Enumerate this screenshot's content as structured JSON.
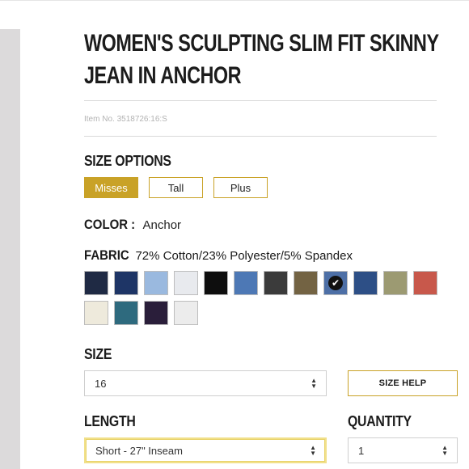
{
  "product": {
    "title": "WOMEN'S SCULPTING SLIM FIT SKINNY JEAN IN ANCHOR",
    "item_number": "Item No. 3518726:16:S"
  },
  "size_options": {
    "label": "SIZE OPTIONS",
    "options": [
      {
        "label": "Misses",
        "selected": true
      },
      {
        "label": "Tall",
        "selected": false
      },
      {
        "label": "Plus",
        "selected": false
      }
    ],
    "active_color": "#c9a227"
  },
  "color": {
    "label": "COLOR :",
    "value": "Anchor"
  },
  "fabric": {
    "label": "FABRIC",
    "value": "72% Cotton/23% Polyester/5% Spandex",
    "swatches": [
      {
        "color": "#1f2a44",
        "selected": false
      },
      {
        "color": "#1e3566",
        "selected": false
      },
      {
        "color": "#9ab9df",
        "selected": false
      },
      {
        "color": "#e8eaee",
        "selected": false
      },
      {
        "color": "#0e0e0e",
        "selected": false
      },
      {
        "color": "#4d78b5",
        "selected": false
      },
      {
        "color": "#3b3b3b",
        "selected": false
      },
      {
        "color": "#736343",
        "selected": false
      },
      {
        "color": "#4d6fa6",
        "selected": true
      },
      {
        "color": "#2d4f86",
        "selected": false
      },
      {
        "color": "#9c9a72",
        "selected": false
      },
      {
        "color": "#c8584b",
        "selected": false
      },
      {
        "color": "#eeeadc",
        "selected": false
      },
      {
        "color": "#2e6a7e",
        "selected": false
      },
      {
        "color": "#2a1e3a",
        "selected": false
      },
      {
        "color": "#ececec",
        "selected": false
      }
    ]
  },
  "size": {
    "label": "SIZE",
    "selected": "16",
    "help_label": "SIZE HELP"
  },
  "length": {
    "label": "LENGTH",
    "selected": "Short - 27\" Inseam"
  },
  "quantity": {
    "label": "QUANTITY",
    "selected": "1"
  }
}
